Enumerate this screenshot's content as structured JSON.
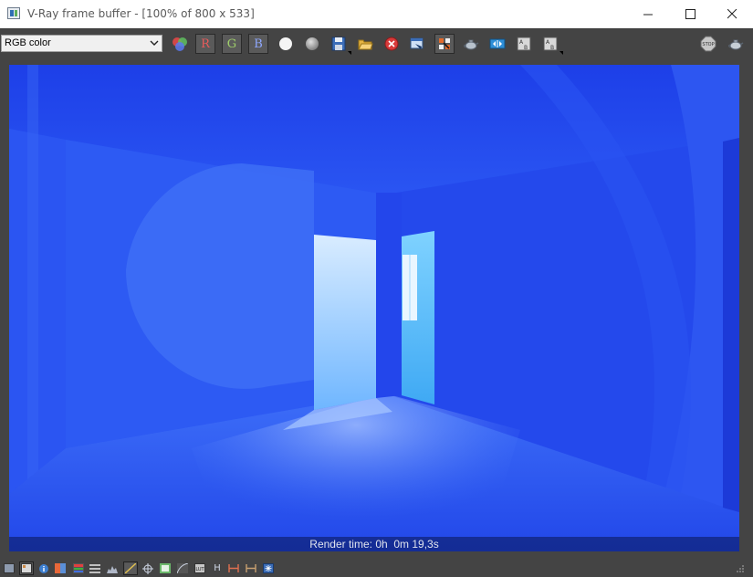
{
  "window": {
    "title": "V-Ray frame buffer - [100% of 800 x 533]",
    "minimize": "minimize",
    "maximize": "maximize",
    "close": "close"
  },
  "toolbar": {
    "channel_select": {
      "value": "RGB color"
    },
    "red_channel_label": "R",
    "green_channel_label": "G",
    "blue_channel_label": "B",
    "colors": {
      "red": "#e85a5a",
      "green": "#9fcf6a",
      "blue": "#8fa8ff"
    }
  },
  "render": {
    "status_label": "Render time:",
    "status_value": "0h  0m 19,3s"
  },
  "bottom_toolbar": {
    "h_label": "H"
  }
}
